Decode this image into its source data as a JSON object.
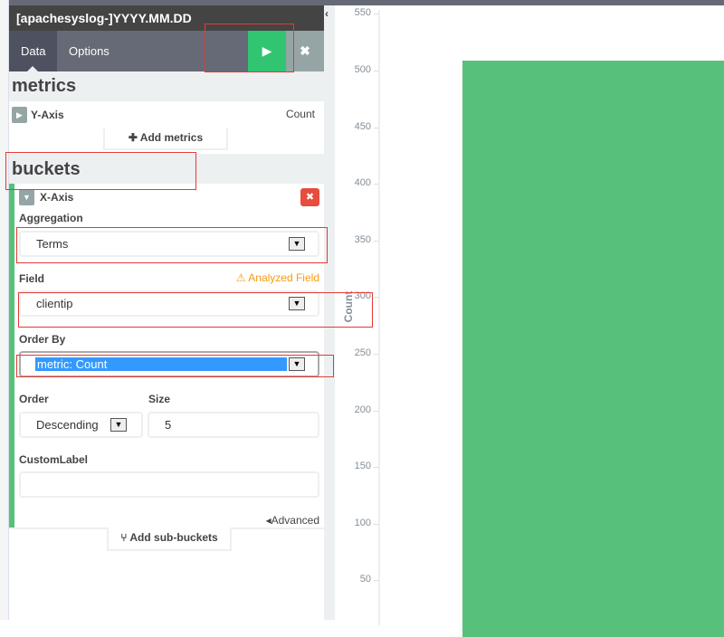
{
  "editor": {
    "index_pattern": "[apachesyslog-]YYYY.MM.DD",
    "tabs": [
      {
        "label": "Data",
        "active": true
      },
      {
        "label": "Options",
        "active": false
      }
    ],
    "apply_icon": "play-icon",
    "discard_icon": "close-icon",
    "collapse_icon": "chevron-left-icon"
  },
  "metrics": {
    "title": "metrics",
    "y_axis": {
      "label": "Y-Axis",
      "value": "Count"
    },
    "add_label": "Add metrics"
  },
  "buckets": {
    "title": "buckets",
    "x_axis": {
      "label": "X-Axis",
      "aggregation_label": "Aggregation",
      "aggregation_value": "Terms",
      "field_label": "Field",
      "field_warning": "Analyzed Field",
      "field_value": "clientip",
      "order_by_label": "Order By",
      "order_by_value": "metric: Count",
      "order_label": "Order",
      "order_value": "Descending",
      "size_label": "Size",
      "size_value": "5",
      "custom_label_label": "CustomLabel",
      "custom_label_value": "",
      "advanced_label": "Advanced"
    },
    "add_sub_label": "Add sub-buckets"
  },
  "colors": {
    "accent_green": "#31c471",
    "bar": "#57c17b",
    "danger": "#e74c3c",
    "warning": "#f39c12"
  },
  "chart_data": {
    "type": "bar",
    "ylabel": "Count",
    "ylim": [
      0,
      550
    ],
    "yticks": [
      550,
      500,
      450,
      400,
      350,
      300,
      250,
      200,
      150,
      100,
      50
    ],
    "values": [
      509
    ]
  }
}
